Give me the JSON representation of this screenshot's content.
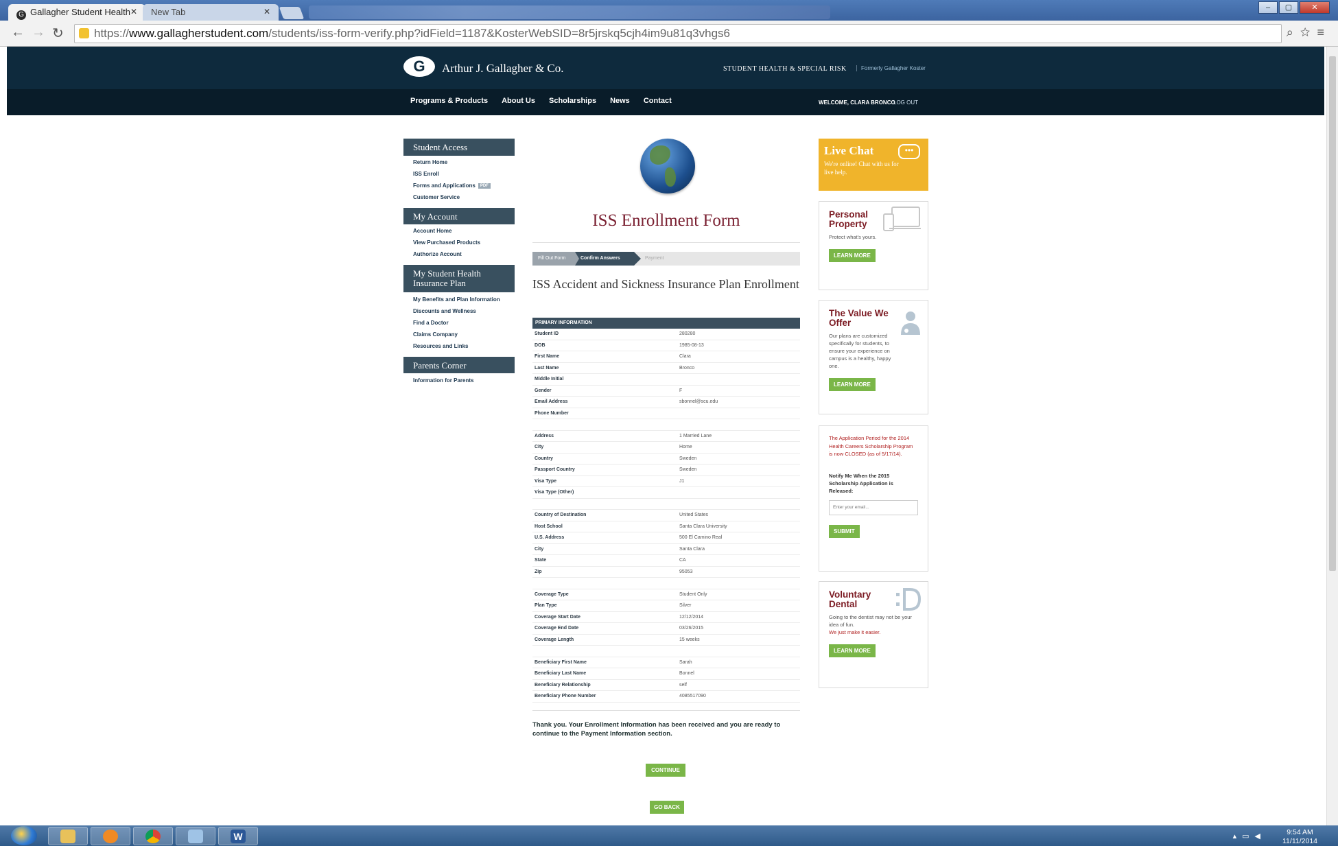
{
  "browser": {
    "active_tab": "Gallagher Student Health",
    "inactive_tab": "New Tab",
    "url_prefix": "https://",
    "url_domain": "www.gallagherstudent.com",
    "url_path": "/students/iss-form-verify.php?idField=1187&KosterWebSID=8r5jrskq5cjh4im9u81q3vhgs6"
  },
  "header": {
    "logo_text": "Arthur J. Gallagher & Co.",
    "tagline": "STUDENT HEALTH & SPECIAL RISK",
    "tagline_sub": "Formerly Gallagher Koster",
    "nav": [
      "Programs & Products",
      "About Us",
      "Scholarships",
      "News",
      "Contact"
    ],
    "welcome": "WELCOME, CLARA BRONCO",
    "logout": "LOG OUT"
  },
  "sidebar": {
    "student_access": {
      "title": "Student Access",
      "links": [
        "Return Home",
        "ISS Enroll",
        "Forms and Applications",
        "Customer Service"
      ],
      "pdf_badge": "PDF"
    },
    "my_account": {
      "title": "My Account",
      "links": [
        "Account Home",
        "View Purchased Products",
        "Authorize Account"
      ]
    },
    "health_plan": {
      "title_line1": "My Student Health",
      "title_line2": "Insurance Plan",
      "links": [
        "My Benefits and Plan Information",
        "Discounts and Wellness",
        "Find a Doctor",
        "Claims Company",
        "Resources and Links"
      ]
    },
    "parents": {
      "title": "Parents Corner",
      "links": [
        "Information for Parents"
      ]
    }
  },
  "main": {
    "page_title": "ISS Enrollment Form",
    "steps": [
      "Fill Out Form",
      "Confirm Answers",
      "Payment"
    ],
    "form_title": "ISS Accident and Sickness Insurance Plan Enrollment",
    "table_header": "PRIMARY INFORMATION",
    "groups": [
      [
        {
          "k": "Student ID",
          "v": "280280"
        },
        {
          "k": "DOB",
          "v": "1985-08-13"
        },
        {
          "k": "First Name",
          "v": "Clara"
        },
        {
          "k": "Last Name",
          "v": "Bronco"
        },
        {
          "k": "Middle Initial",
          "v": ""
        },
        {
          "k": "Gender",
          "v": "F"
        },
        {
          "k": "Email Address",
          "v": "sbonnel@scu.edu"
        },
        {
          "k": "Phone Number",
          "v": ""
        }
      ],
      [
        {
          "k": "Address",
          "v": "1 Married Lane"
        },
        {
          "k": "City",
          "v": "Home"
        },
        {
          "k": "Country",
          "v": "Sweden"
        },
        {
          "k": "Passport Country",
          "v": "Sweden"
        },
        {
          "k": "Visa Type",
          "v": "J1"
        },
        {
          "k": "Visa Type (Other)",
          "v": ""
        }
      ],
      [
        {
          "k": "Country of Destination",
          "v": "United States"
        },
        {
          "k": "Host School",
          "v": "Santa Clara University"
        },
        {
          "k": "U.S. Address",
          "v": "500 El Camino Real"
        },
        {
          "k": "City",
          "v": "Santa Clara"
        },
        {
          "k": "State",
          "v": "CA"
        },
        {
          "k": "Zip",
          "v": "95053"
        }
      ],
      [
        {
          "k": "Coverage Type",
          "v": "Student Only"
        },
        {
          "k": "Plan Type",
          "v": "Silver"
        },
        {
          "k": "Coverage Start Date",
          "v": "12/12/2014"
        },
        {
          "k": "Coverage End Date",
          "v": "03/26/2015"
        },
        {
          "k": "Coverage Length",
          "v": "15 weeks"
        }
      ],
      [
        {
          "k": "Beneficiary First Name",
          "v": "Sarah"
        },
        {
          "k": "Beneficiary Last Name",
          "v": "Bonnel"
        },
        {
          "k": "Beneficiary Relationship",
          "v": "self"
        },
        {
          "k": "Beneficiary Phone Number",
          "v": "4085517090"
        }
      ]
    ],
    "thanks": "Thank you. Your Enrollment Information has been received and you are ready to continue to the Payment Information section.",
    "continue_label": "CONTINUE",
    "goback_label": "GO BACK"
  },
  "right": {
    "live_chat_title": "Live Chat",
    "live_chat_sub": "We're online! Chat with us for live help.",
    "personal_property": {
      "title_line1": "Personal",
      "title_line2": "Property",
      "text": "Protect what's yours.",
      "button": "LEARN MORE"
    },
    "value": {
      "title_line1": "The Value We",
      "title_line2": "Offer",
      "text": "Our plans are customized specifically for students, to ensure your experience on campus is a healthy, happy one.",
      "button": "LEARN MORE"
    },
    "scholarship": {
      "note": "The Application Period for the 2014 Health Careers Scholarship Program is now CLOSED (as of 5/17/14).",
      "notify": "Notify Me When the 2015 Scholarship Application is Released:",
      "placeholder": "Enter your email...",
      "button": "SUBMIT"
    },
    "dental": {
      "title_line1": "Voluntary",
      "title_line2": "Dental",
      "text": "Going to the dentist may not be your idea of fun.",
      "red_text": "We just make it easier.",
      "button": "LEARN MORE"
    }
  },
  "taskbar": {
    "time": "9:54 AM",
    "date": "11/11/2014"
  }
}
